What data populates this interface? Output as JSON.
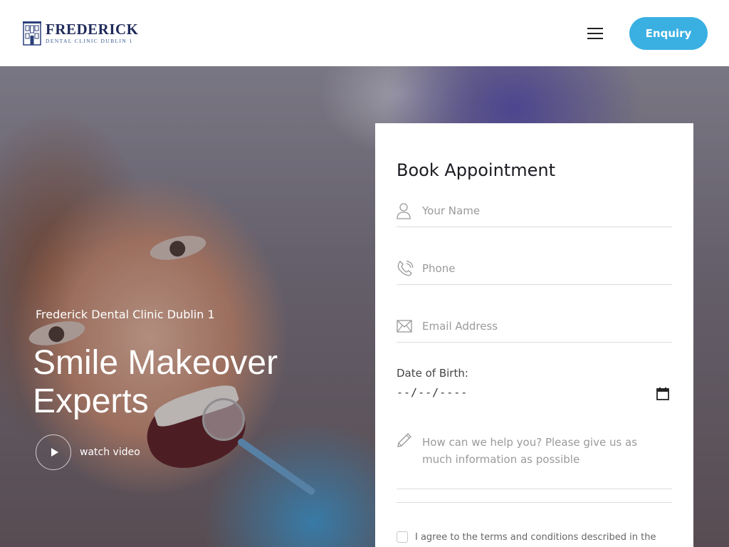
{
  "header": {
    "logo_title": "FREDERICK",
    "logo_subtitle": "DENTAL CLINIC DUBLIN 1",
    "menu_icon": "hamburger-menu-icon",
    "enquiry_label": "Enquiry"
  },
  "hero": {
    "subtitle": "Frederick Dental Clinic Dublin 1",
    "title": "Smile Makeover Experts",
    "watch_video_label": "watch video"
  },
  "form": {
    "title": "Book Appointment",
    "name_placeholder": "Your Name",
    "phone_placeholder": "Phone",
    "email_placeholder": "Email Address",
    "dob_label": "Date of Birth:",
    "dob_value": "--/--/----",
    "message_placeholder": "How can we help you? Please give us as much information as possible",
    "terms_text": "I agree to the terms and conditions described in the"
  },
  "colors": {
    "accent": "#3ab0e2",
    "brand_navy": "#1f2a5a"
  }
}
